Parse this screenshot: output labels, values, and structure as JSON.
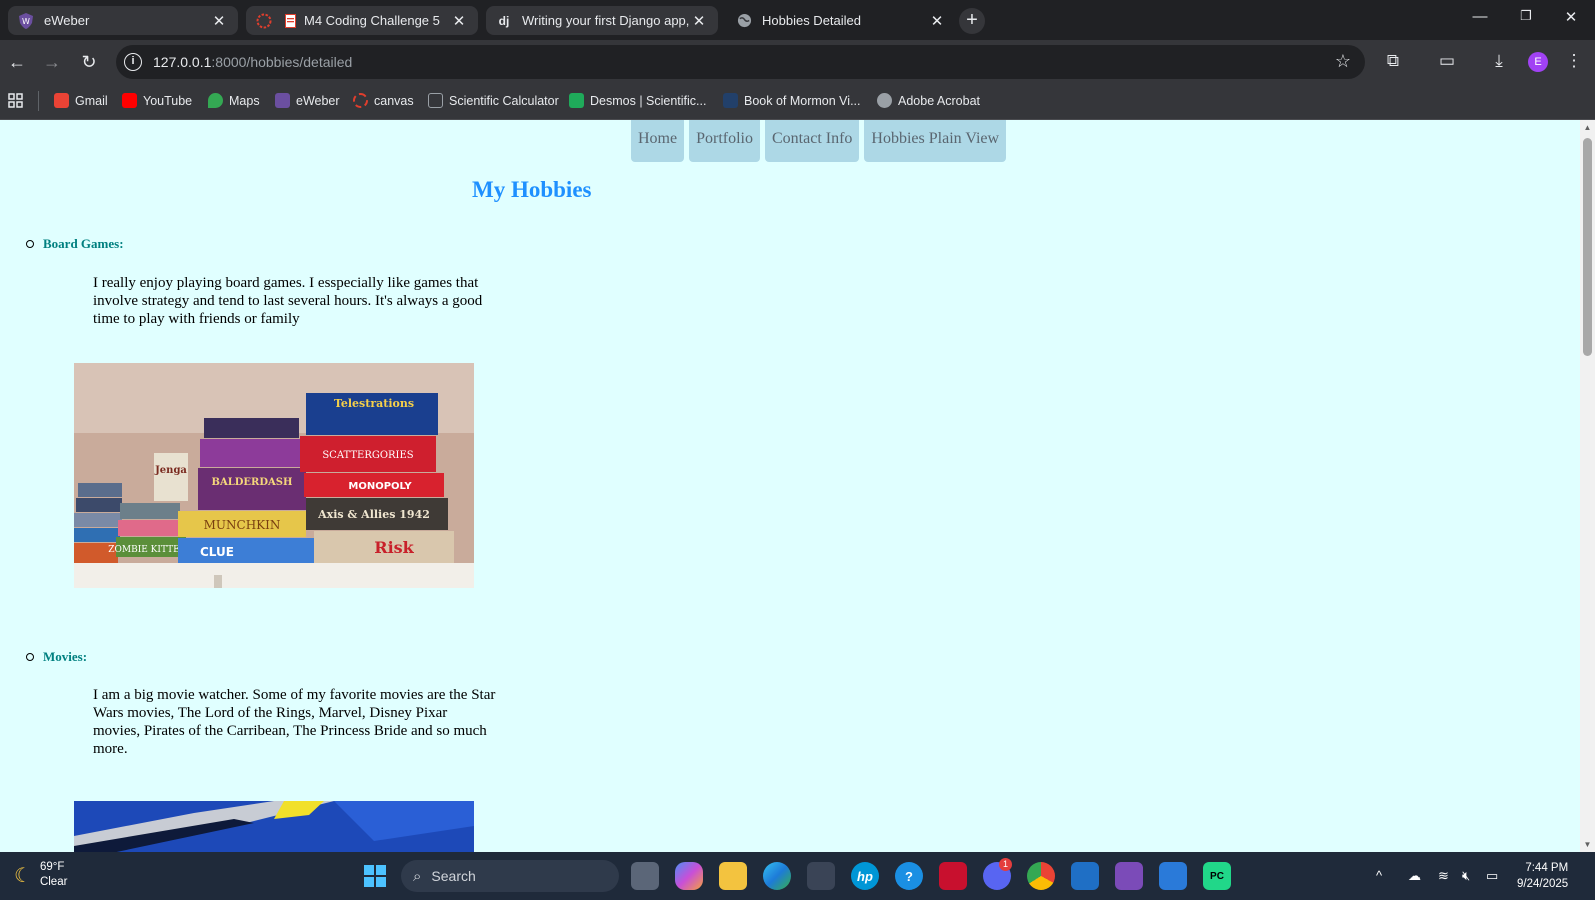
{
  "browser": {
    "tabs": [
      {
        "title": "eWeber",
        "favicon": "shield-icon",
        "state": "inactive"
      },
      {
        "title": "M4 Coding Challenge 5",
        "favicon": "canvas-doc-icon",
        "state": "inactive"
      },
      {
        "title": "Writing your first Django app, p",
        "favicon": "django-icon",
        "favicon_text": "dj",
        "state": "inactive"
      },
      {
        "title": "Hobbies Detailed",
        "favicon": "globe-icon",
        "state": "active"
      }
    ],
    "new_tab": "+",
    "address": {
      "host": "127.0.0.1",
      "path": ":8000/hobbies/detailed"
    },
    "profile_initial": "E",
    "bookmarks": [
      {
        "label": "Gmail",
        "icon": "gmail-icon",
        "color": "#ea4335"
      },
      {
        "label": "YouTube",
        "icon": "youtube-icon",
        "color": "#ff0000"
      },
      {
        "label": "Maps",
        "icon": "maps-icon",
        "color": "#34a853"
      },
      {
        "label": "eWeber",
        "icon": "shield-icon",
        "color": "#6b4fa0"
      },
      {
        "label": "canvas",
        "icon": "canvas-icon",
        "color": "#e03e2d"
      },
      {
        "label": "Scientific Calculator",
        "icon": "calculator-icon",
        "color": "#9aa0a6"
      },
      {
        "label": "Desmos | Scientific...",
        "icon": "desmos-icon",
        "color": "#1faa5a"
      },
      {
        "label": "Book of Mormon Vi...",
        "icon": "book-icon",
        "color": "#22406a"
      },
      {
        "label": "Adobe Acrobat",
        "icon": "globe-icon",
        "color": "#9aa0a6"
      }
    ]
  },
  "page": {
    "nav": [
      "Home",
      "Portfolio",
      "Contact Info",
      "Hobbies Plain View"
    ],
    "title": "My Hobbies",
    "hobbies": [
      {
        "name": "Board Games:",
        "description": "I really enjoy playing board games. I esspecially like games that involve strategy and tend to last several hours. It's always a good time to play with friends or family"
      },
      {
        "name": "Movies:",
        "description": "I am a big movie watcher. Some of my favorite movies are the Star Wars movies, The Lord of the Rings, Marvel, Disney Pixar movies, Pirates of the Carribean, The Princess Bride and so much more."
      }
    ],
    "game_box_labels": [
      "Telestrations",
      "SCATTERGORIES",
      "MONOPOLY",
      "Axis & Allies 1942",
      "Risk",
      "BALDERDASH",
      "Jenga",
      "MUNCHKIN",
      "CLUE",
      "ZOMBIE KITTENS"
    ]
  },
  "taskbar": {
    "weather": {
      "temp": "69°F",
      "condition": "Clear"
    },
    "search_placeholder": "Search",
    "discord_badge": "1",
    "time": "7:44 PM",
    "date": "9/24/2025"
  }
}
